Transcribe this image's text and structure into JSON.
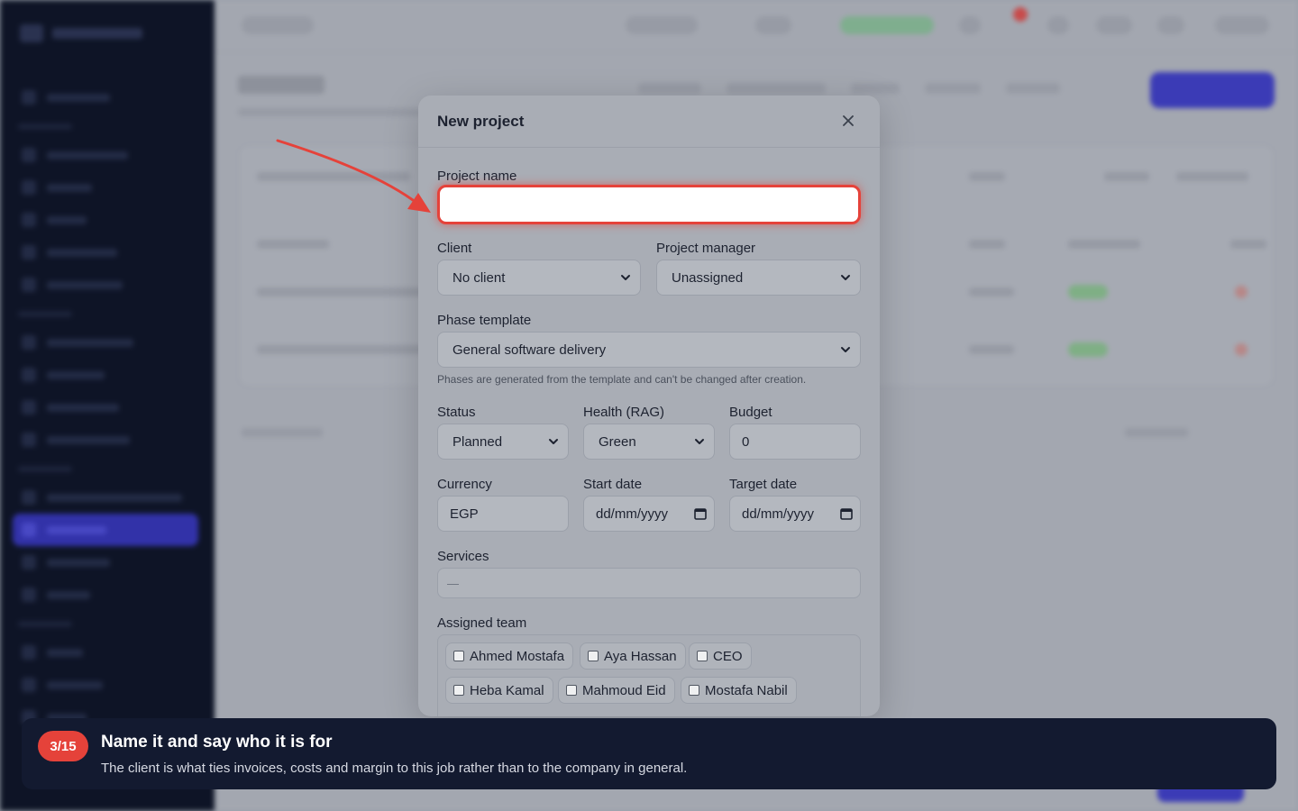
{
  "modal": {
    "title": "New project",
    "close_icon": "close-icon",
    "project_name": {
      "label": "Project name",
      "value": ""
    },
    "client": {
      "label": "Client",
      "selected": "No client"
    },
    "project_manager": {
      "label": "Project manager",
      "selected": "Unassigned"
    },
    "phase_template": {
      "label": "Phase template",
      "selected": "General software delivery",
      "helper": "Phases are generated from the template and can't be changed after creation."
    },
    "status": {
      "label": "Status",
      "selected": "Planned"
    },
    "health": {
      "label": "Health (RAG)",
      "selected": "Green"
    },
    "budget": {
      "label": "Budget",
      "value": "0"
    },
    "currency": {
      "label": "Currency",
      "value": "EGP"
    },
    "start_date": {
      "label": "Start date",
      "placeholder": "dd/mm/yyyy"
    },
    "target_date": {
      "label": "Target date",
      "placeholder": "dd/mm/yyyy"
    },
    "services": {
      "label": "Services",
      "value": "—"
    },
    "assigned_team": {
      "label": "Assigned team",
      "members": [
        "Ahmed Mostafa",
        "Aya Hassan",
        "CEO",
        "Heba Kamal",
        "Mahmoud Eid",
        "Mostafa Nabil"
      ]
    }
  },
  "tour": {
    "step": "3/15",
    "title": "Name it and say who it is for",
    "body": "The client is what ties invoices, costs and margin to this job rather than to the company in general."
  },
  "colors": {
    "highlight": "#e5423a",
    "tour_bg": "#131a30",
    "accent": "#3b3bb6"
  }
}
